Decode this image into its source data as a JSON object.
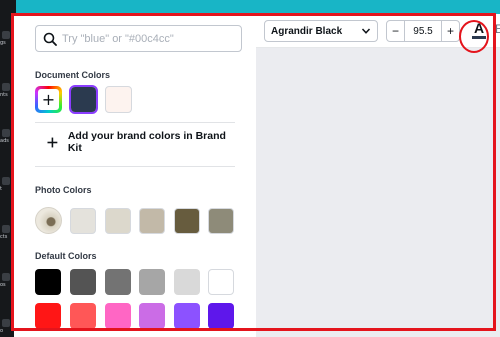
{
  "left_rail": {
    "items": [
      {
        "label": "gs",
        "icon": "design-icon"
      },
      {
        "label": "nts",
        "icon": "elements-icon"
      },
      {
        "label": "ads",
        "icon": "uploads-icon"
      },
      {
        "label": "t",
        "icon": "text-icon"
      },
      {
        "label": "cts",
        "icon": "projects-icon"
      },
      {
        "label": "os",
        "icon": "apps-icon"
      },
      {
        "label": "o",
        "icon": "photo-icon"
      }
    ]
  },
  "color_panel": {
    "search": {
      "placeholder": "Try \"blue\" or \"#00c4cc\"",
      "value": ""
    },
    "document_colors": {
      "title": "Document Colors",
      "add_label": "+",
      "swatches": [
        "#2b3a4f",
        "#fdf3ef"
      ],
      "selected": "#2b3a4f"
    },
    "brand_kit": {
      "label": "Add your brand colors in Brand Kit"
    },
    "photo_colors": {
      "title": "Photo Colors",
      "swatches": [
        "#e4e2dc",
        "#dcd8cc",
        "#c2b9a8",
        "#675c3e",
        "#8e8b79"
      ]
    },
    "default_colors": {
      "title": "Default Colors",
      "swatches": [
        "#000000",
        "#545454",
        "#737373",
        "#a6a6a6",
        "#d9d9d9",
        "#ffffff",
        "#ff1616",
        "#ff5757",
        "#ff66c4",
        "#cb6ce6",
        "#8c52ff",
        "#5e17eb"
      ]
    }
  },
  "toolbar": {
    "font_name": "Agrandir Black",
    "font_size": "95.5",
    "minus_label": "−",
    "plus_label": "+",
    "text_color_label": "A",
    "text_color": "#2b3a4f",
    "more_label": "E"
  },
  "colors": {
    "accent": "#8b3dff",
    "annotation": "#e4141c",
    "header_teal": "#18b5c6",
    "rail_bg": "#16181b"
  }
}
